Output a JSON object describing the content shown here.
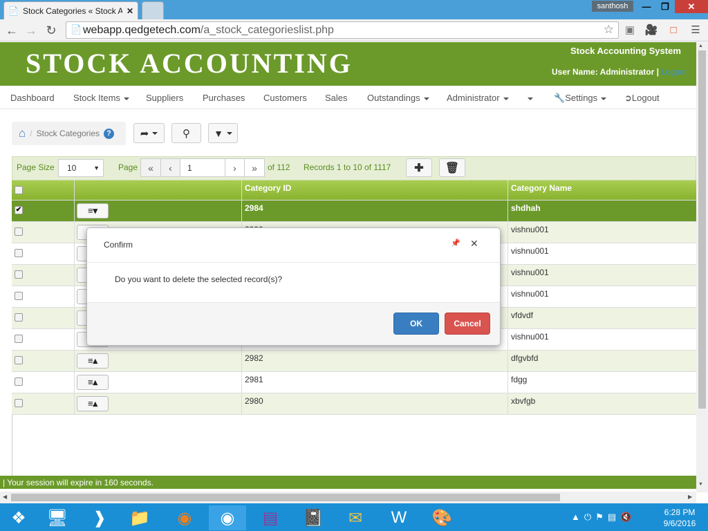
{
  "browser": {
    "tab_title": "Stock Categories « Stock A",
    "user_badge": "santhosh",
    "url_host": "webapp.qedgetech.com",
    "url_path": "/a_stock_categorieslist.php"
  },
  "header": {
    "brand": "STOCK ACCOUNTING",
    "system_name": "Stock Accounting System",
    "user_label": "User Name: Administrator |",
    "logout_link": "Logout"
  },
  "menu": {
    "items": [
      "Dashboard",
      "Stock Items",
      "Suppliers",
      "Purchases",
      "Customers",
      "Sales",
      "Outstandings",
      "Administrator",
      "",
      "Settings",
      "Logout"
    ]
  },
  "breadcrumb": {
    "label": "Stock Categories"
  },
  "pager": {
    "page_size_label": "Page Size",
    "page_size_value": "10",
    "page_label": "Page",
    "page_value": "1",
    "of_pages": "of 112",
    "records": "Records 1 to 10 of 1117"
  },
  "table": {
    "headers": [
      "",
      "",
      "Category ID",
      "Category Name"
    ],
    "rows": [
      {
        "id": "2984",
        "name": "shdhah",
        "checked": true
      },
      {
        "id": "2990",
        "name": "vishnu001",
        "checked": false
      },
      {
        "id": "",
        "name": "vishnu001",
        "checked": false
      },
      {
        "id": "",
        "name": "vishnu001",
        "checked": false
      },
      {
        "id": "",
        "name": "vishnu001",
        "checked": false
      },
      {
        "id": "",
        "name": "vfdvdf",
        "checked": false
      },
      {
        "id": "",
        "name": "vishnu001",
        "checked": false
      },
      {
        "id": "2982",
        "name": "dfgvbfd",
        "checked": false
      },
      {
        "id": "2981",
        "name": "fdgg",
        "checked": false
      },
      {
        "id": "2980",
        "name": "xbvfgb",
        "checked": false
      }
    ]
  },
  "status": {
    "text": "| Your session will expire in 160 seconds."
  },
  "dialog": {
    "title": "Confirm",
    "message": "Do you want to delete the selected record(s)?",
    "ok": "OK",
    "cancel": "Cancel"
  },
  "taskbar": {
    "time": "6:28 PM",
    "date": "9/6/2016"
  },
  "colors": {
    "brand_green": "#6b9a2a",
    "header_gradient_top": "#a9cd51",
    "ok_blue": "#3a7ec2",
    "cancel_red": "#d9534f",
    "taskbar_blue": "#1b8fd5"
  }
}
